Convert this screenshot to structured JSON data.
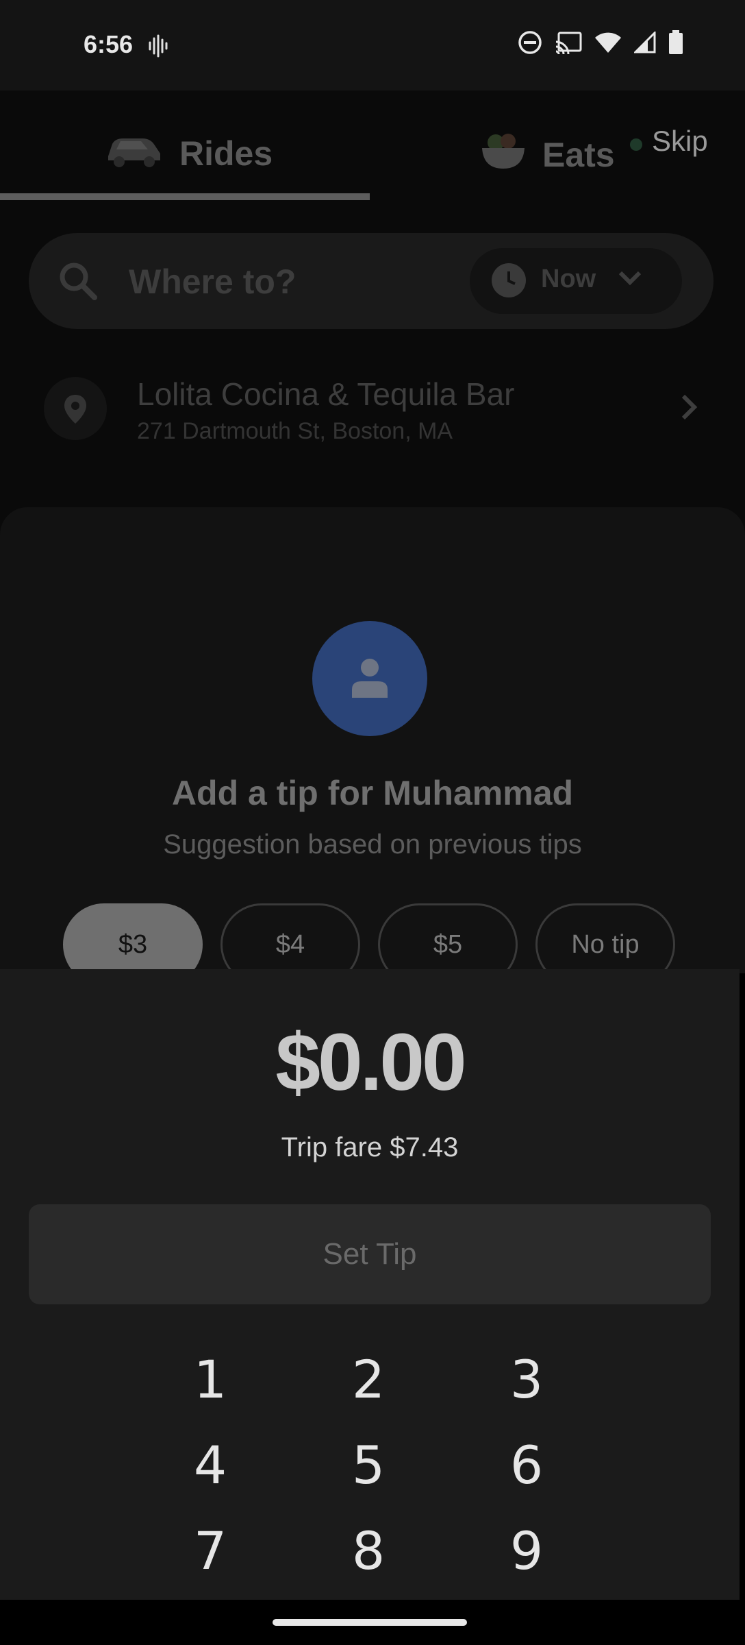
{
  "status_bar": {
    "time": "6:56",
    "icons": [
      "sound-wave-icon",
      "do-not-disturb-icon",
      "cast-icon",
      "wifi-icon",
      "signal-icon",
      "battery-icon"
    ]
  },
  "tabs": [
    {
      "label": "Rides",
      "icon": "car-icon",
      "selected": true
    },
    {
      "label": "Eats",
      "icon": "food-bowl-icon",
      "selected": false
    }
  ],
  "skip_label": "Skip",
  "search": {
    "placeholder": "Where to?",
    "time_selector": "Now"
  },
  "saved_place": {
    "title": "Lolita Cocina & Tequila Bar",
    "address": "271 Dartmouth St, Boston, MA"
  },
  "tip": {
    "title": "Add a tip for Muhammad",
    "subtitle": "Suggestion based on previous tips",
    "options": [
      "$3",
      "$4",
      "$5",
      "No tip"
    ],
    "selected_option": "$3",
    "amount": "$0.00",
    "fare": "Trip fare $7.43",
    "set_button": "Set Tip"
  },
  "keypad": [
    "1",
    "2",
    "3",
    "4",
    "5",
    "6",
    "7",
    "8",
    "9"
  ],
  "colors": {
    "avatar_bg": "#2a4478",
    "panel_bg": "#1b1b1b",
    "button_bg": "#2a2a2a"
  }
}
